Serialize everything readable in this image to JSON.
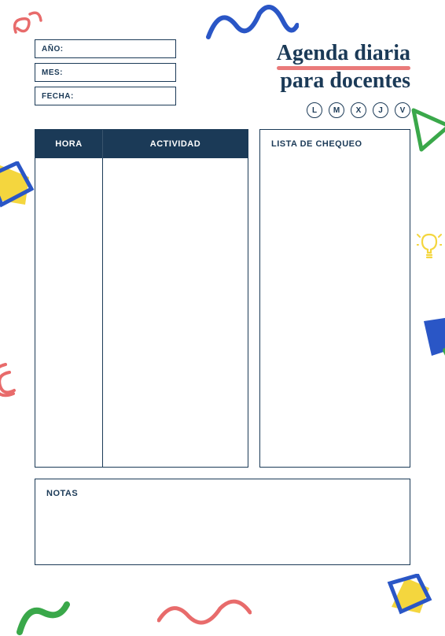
{
  "header": {
    "date_fields": {
      "year_label": "AÑO:",
      "month_label": "MES:",
      "date_label": "FECHA:"
    },
    "title": {
      "line1": "Agenda diaria",
      "line2": "para docentes"
    },
    "weekdays": [
      "L",
      "M",
      "X",
      "J",
      "V"
    ]
  },
  "schedule": {
    "hora_label": "HORA",
    "actividad_label": "ACTIVIDAD"
  },
  "checklist": {
    "title": "LISTA DE CHEQUEO"
  },
  "notes": {
    "title": "NOTAS"
  }
}
